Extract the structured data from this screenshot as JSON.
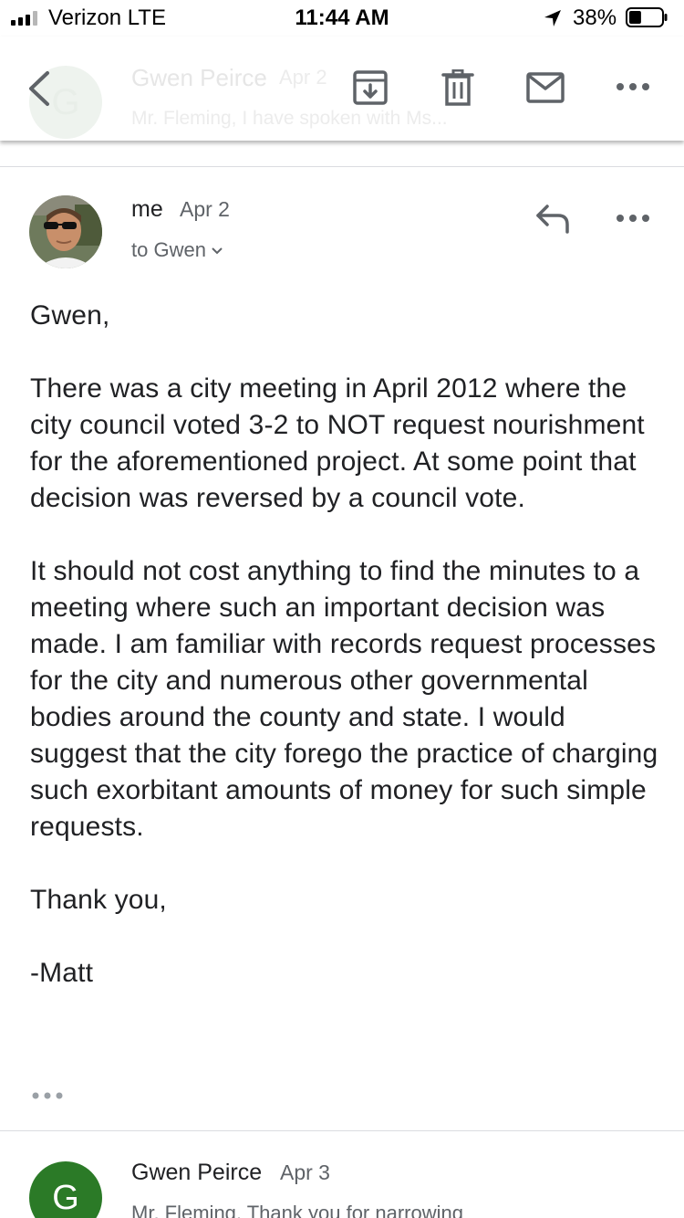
{
  "status_bar": {
    "carrier": "Verizon  LTE",
    "time": "11:44 AM",
    "battery": "38%",
    "battery_level": 0.38
  },
  "toolbar": {
    "prev_sender": "Gwen Peirce",
    "prev_date": "Apr 2",
    "prev_snippet": "Mr. Fleming, I have spoken with Ms...",
    "prev_initial": "G"
  },
  "message": {
    "sender": "me",
    "date": "Apr 2",
    "recipient": "to Gwen",
    "body": [
      "Gwen,",
      "There was a city meeting in April 2012 where the city council voted 3-2 to NOT request nourishment for the aforementioned project. At some point that decision was reversed by a council vote.",
      "It should not cost anything to find the minutes to a meeting where such an important decision was made. I am familiar with records request processes for the city and numerous other governmental bodies around the county and state. I would suggest that the city forego the practice of charging such exorbitant amounts of money for such simple requests.",
      "Thank you,",
      "-Matt"
    ]
  },
  "next_message": {
    "initial": "G",
    "sender": "Gwen Peirce",
    "date": "Apr 3",
    "snippet": "Mr. Fleming, Thank you for narrowing"
  },
  "colors": {
    "avatar_green": "#2b7a27",
    "icon_gray": "#5f6368",
    "text": "#202124"
  }
}
